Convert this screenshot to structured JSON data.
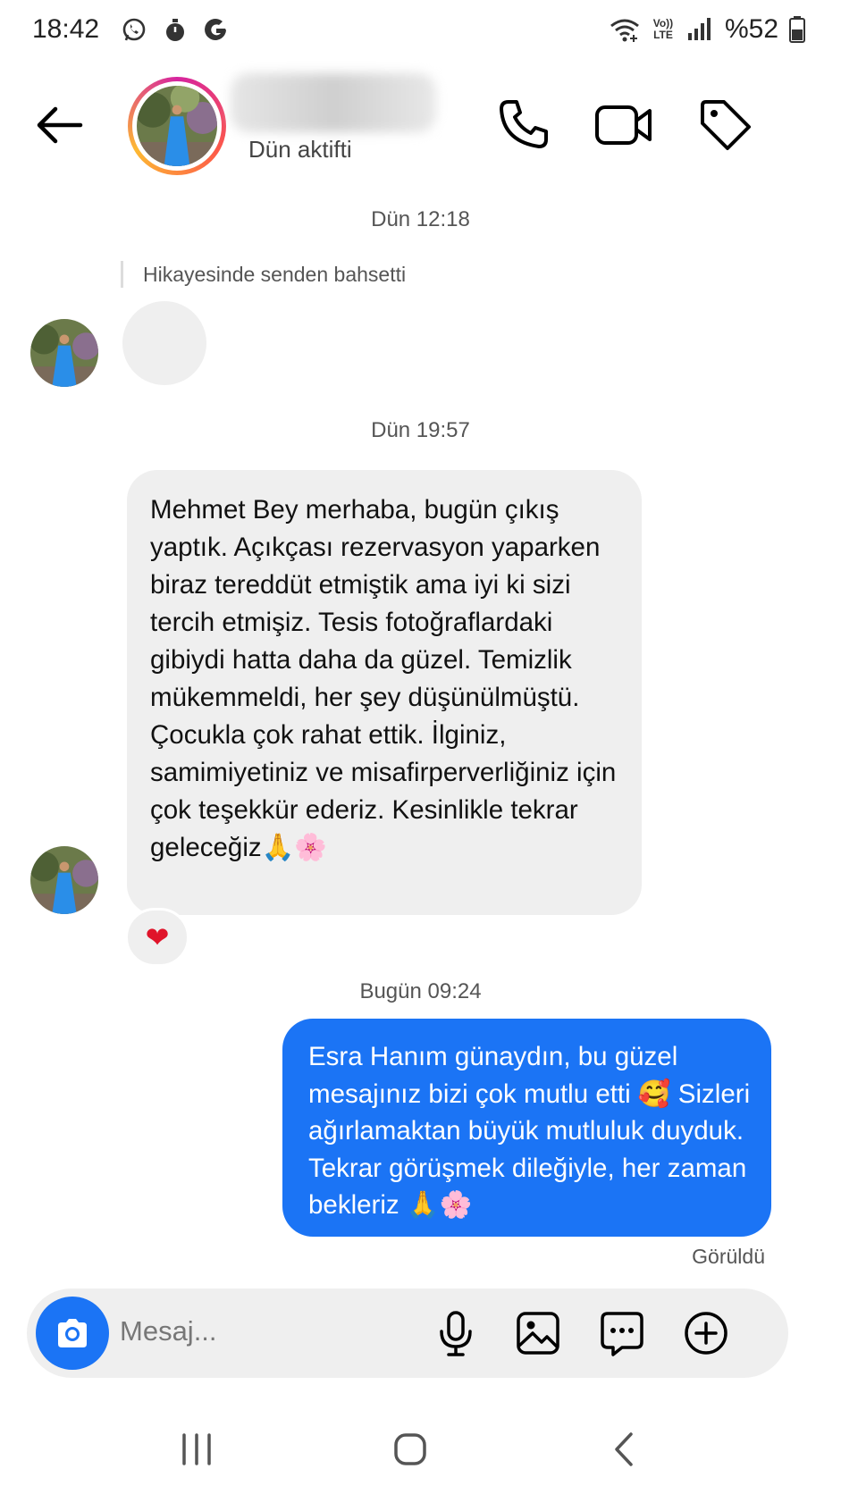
{
  "status_bar": {
    "time": "18:42",
    "battery_text": "%52",
    "left_icons": [
      "whatsapp-icon",
      "timer-icon",
      "google-icon"
    ],
    "right_icons": [
      "wifi-icon",
      "volte-icon",
      "signal-icon",
      "battery-icon"
    ],
    "volte_label": "Vo)) LTE"
  },
  "header": {
    "status": "Dün aktifti",
    "icons": [
      "back-arrow-icon",
      "phone-icon",
      "video-icon",
      "tag-icon"
    ]
  },
  "messages": {
    "ts1": "Dün 12:18",
    "mention_note": "Hikayesinde senden bahsetti",
    "ts2": "Dün 19:57",
    "incoming_text": "Mehmet Bey merhaba, bugün çıkış yaptık. Açıkçası rezervasyon yaparken biraz tereddüt etmiştik ama iyi ki sizi tercih etmişiz. Tesis fotoğraflardaki gibiydi hatta daha da güzel. Temizlik mükemmeldi, her şey düşünülmüştü. Çocukla çok rahat ettik. İlginiz, samimiyetiniz ve misafirperverliğiniz için çok teşekkür ederiz. Kesinlikle tekrar geleceğiz🙏🌸",
    "reaction": "❤",
    "ts3": "Bugün 09:24",
    "outgoing_text": "Esra Hanım günaydın, bu güzel mesajınız bizi çok mutlu etti 🥰 Sizleri ağırlamaktan büyük mutluluk duyduk. Tekrar görüşmek dileğiyle, her zaman bekleriz 🙏🌸",
    "seen": "Görüldü"
  },
  "composer": {
    "placeholder": "Mesaj...",
    "icons": [
      "camera-icon",
      "microphone-icon",
      "gallery-icon",
      "sticker-icon",
      "plus-icon"
    ]
  },
  "nav": {
    "icons": [
      "recent-apps-icon",
      "home-icon",
      "back-icon"
    ]
  },
  "colors": {
    "accent": "#1b74f5",
    "bubble_in": "#efefef",
    "text_secondary": "#555555"
  }
}
